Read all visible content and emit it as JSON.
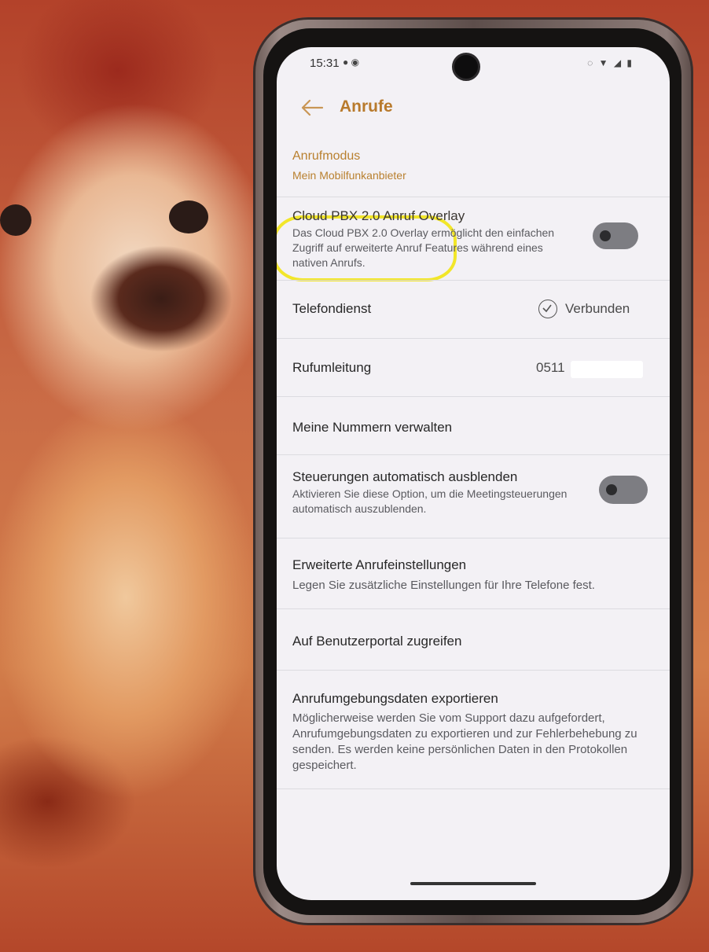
{
  "status": {
    "time": "15:31"
  },
  "header": {
    "title": "Anrufe"
  },
  "settings": {
    "call_mode": {
      "title": "Anrufmodus",
      "value": "Mein Mobilfunkanbieter"
    },
    "overlay": {
      "title": "Cloud PBX 2.0 Anruf Overlay",
      "description": "Das Cloud PBX 2.0 Overlay ermöglicht den einfachen Zugriff auf erweiterte Anruf Features während eines nativen Anrufs.",
      "enabled": false
    },
    "phone_service": {
      "title": "Telefondienst",
      "status": "Verbunden"
    },
    "forwarding": {
      "title": "Rufumleitung",
      "number_prefix": "0511"
    },
    "manage_numbers": {
      "title": "Meine Nummern verwalten"
    },
    "auto_hide": {
      "title": "Steuerungen automatisch ausblenden",
      "description": "Aktivieren Sie diese Option, um die Meetingsteuerungen automatisch auszublenden.",
      "enabled": false
    },
    "advanced": {
      "title": "Erweiterte Anrufeinstellungen",
      "description": "Legen Sie zusätzliche Einstellungen für Ihre Telefone fest."
    },
    "portal": {
      "title": "Auf Benutzerportal zugreifen"
    },
    "export": {
      "title": "Anrufumgebungsdaten exportieren",
      "description": "Möglicherweise werden Sie vom Support dazu aufgefordert, Anrufumgebungsdaten zu exportieren und zur Fehlerbehebung zu senden. Es werden keine persönlichen Daten in den Protokollen gespeichert."
    }
  },
  "colors": {
    "accent": "#b87a2c",
    "highlight": "#f2e629",
    "toggle_off": "#7d7d82"
  },
  "icons": [
    "back-arrow-icon",
    "check-circle-icon",
    "wifi-icon",
    "signal-icon",
    "battery-icon"
  ]
}
